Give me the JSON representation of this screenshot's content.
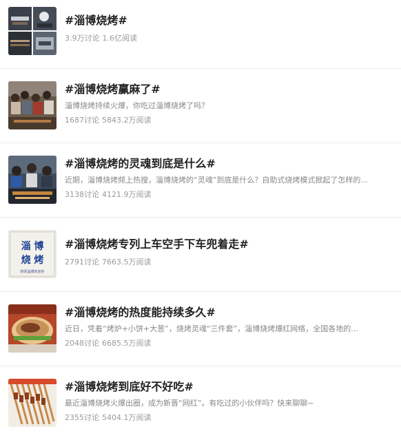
{
  "topics": [
    {
      "title": "#淄博烧烤#",
      "desc": "",
      "discussions": "3.9万讨论",
      "reads": "1.6亿阅读",
      "thumb_icon": "bbq-collage-image"
    },
    {
      "title": "#淄博烧烤赢麻了#",
      "desc": "淄博烧烤持续火爆，你吃过淄博烧烤了吗？",
      "discussions": "1687讨论",
      "reads": "5843.2万阅读",
      "thumb_icon": "crowd-bbq-image"
    },
    {
      "title": "#淄博烧烤的灵魂到底是什么#",
      "desc": "近期，淄博烧烤频上热搜，淄博烧烤的“灵魂”到底是什么？自助式烧烤模式掀起了怎样的...",
      "discussions": "3138讨论",
      "reads": "4121.9万阅读",
      "thumb_icon": "grill-people-image"
    },
    {
      "title": "#淄博烧烤专列上车空手下车兜着走#",
      "desc": "",
      "discussions": "2791讨论",
      "reads": "7663.5万阅读",
      "thumb_icon": "train-sign-image",
      "thumb_text_1": "淄 博",
      "thumb_text_2": "烧 烤",
      "thumb_text_small": "热情淄博欢迎你"
    },
    {
      "title": "#淄博烧烤的热度能持续多久#",
      "desc": "近日，凭着“烤炉+小饼+大葱”，烧烤灵魂“三件套”，淄博烧烤爆红网络，全国各地的...",
      "discussions": "2048讨论",
      "reads": "6685.5万阅读",
      "thumb_icon": "wrap-food-image"
    },
    {
      "title": "#淄博烧烤到底好不好吃#",
      "desc": "最近淄博烧烤火爆出圈，成为新晋“网红”。有吃过的小伙伴吗？快来聊聊~",
      "discussions": "2355讨论",
      "reads": "5404.1万阅读",
      "thumb_icon": "skewers-image"
    }
  ],
  "colors": {
    "title": "#222222",
    "desc": "#888888",
    "stats": "#999999",
    "divider": "#ececec"
  }
}
